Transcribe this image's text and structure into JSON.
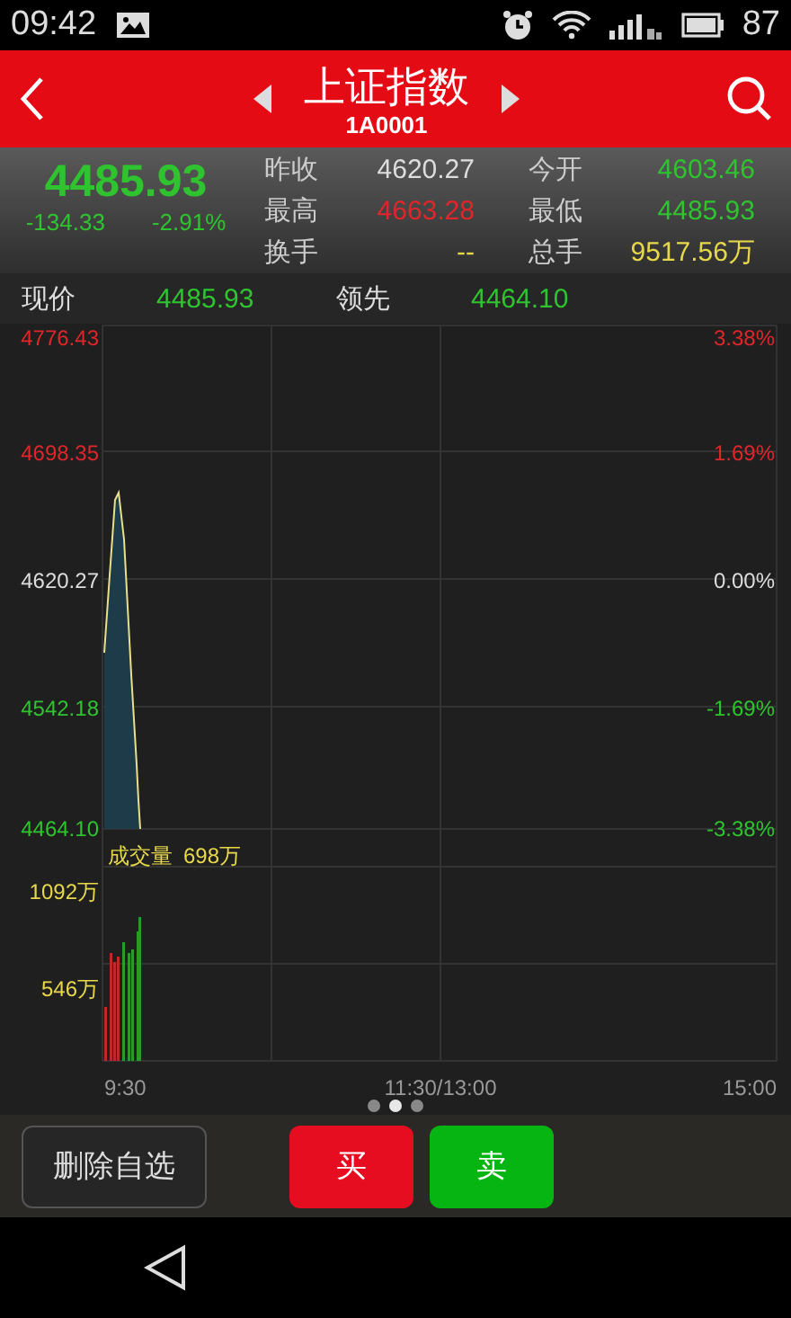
{
  "status_bar": {
    "time": "09:42",
    "battery": "87"
  },
  "header": {
    "title": "上证指数",
    "code": "1A0001"
  },
  "quote": {
    "price": "4485.93",
    "change": "-134.33",
    "change_pct": "-2.91%",
    "color": "#2fc42f",
    "stats": [
      {
        "label": "昨收",
        "value": "4620.27",
        "color": "#dddddd"
      },
      {
        "label": "今开",
        "value": "4603.46",
        "color": "#2fc42f"
      },
      {
        "label": "最高",
        "value": "4663.28",
        "color": "#e0262a"
      },
      {
        "label": "最低",
        "value": "4485.93",
        "color": "#2fc42f"
      },
      {
        "label": "换手",
        "value": "--",
        "color": "#e6d84a"
      },
      {
        "label": "总手",
        "value": "9517.56万",
        "color": "#e6d84a"
      }
    ]
  },
  "live": [
    {
      "label": "现价",
      "value": "4485.93",
      "color": "#2fc42f"
    },
    {
      "label": "领先",
      "value": "4464.10",
      "color": "#2fc42f"
    }
  ],
  "chart": {
    "left_labels": [
      {
        "text": "4776.43",
        "color": "#e0262a"
      },
      {
        "text": "4698.35",
        "color": "#e0262a"
      },
      {
        "text": "4620.27",
        "color": "#dddddd"
      },
      {
        "text": "4542.18",
        "color": "#2fc42f"
      },
      {
        "text": "4464.10",
        "color": "#2fc42f"
      }
    ],
    "right_labels": [
      {
        "text": "3.38%",
        "color": "#e0262a"
      },
      {
        "text": "1.69%",
        "color": "#e0262a"
      },
      {
        "text": "0.00%",
        "color": "#dddddd"
      },
      {
        "text": "-1.69%",
        "color": "#2fc42f"
      },
      {
        "text": "-3.38%",
        "color": "#2fc42f"
      }
    ],
    "volume_title": "成交量",
    "volume_value": "698万",
    "volume_labels": [
      "1092万",
      "546万"
    ],
    "time_labels": [
      "9:30",
      "11:30/13:00",
      "15:00"
    ]
  },
  "page_dots": [
    {
      "selected": false
    },
    {
      "selected": true
    },
    {
      "selected": false
    }
  ],
  "buttons": [
    {
      "label": "删除自选",
      "kind": "outline"
    },
    {
      "label": "买",
      "kind": "buy"
    },
    {
      "label": "卖",
      "kind": "sell"
    }
  ]
}
